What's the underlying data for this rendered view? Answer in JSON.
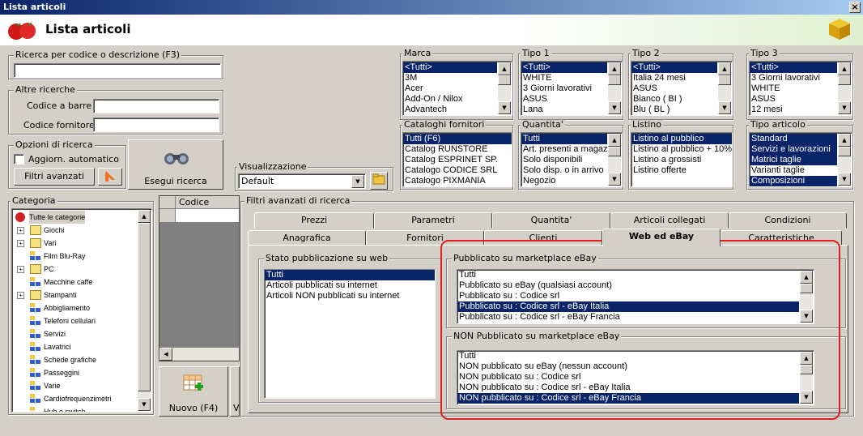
{
  "window": {
    "title": "Lista articoli"
  },
  "header": {
    "title": "Lista articoli"
  },
  "search": {
    "label": "Ricerca per codice o descrizione (F3)",
    "value": ""
  },
  "altre": {
    "label": "Altre ricerche",
    "barcode_label": "Codice a barre :",
    "supplier_label": "Codice fornitore :"
  },
  "opzioni": {
    "label": "Opzioni di ricerca",
    "auto_label": "Aggiorn. automatico",
    "filters_label": "Filtri avanzati"
  },
  "esegui": {
    "label": "Esegui ricerca"
  },
  "visualizzazione": {
    "label": "Visualizzazione",
    "value": "Default"
  },
  "marca": {
    "label": "Marca",
    "items": [
      "<Tutti>",
      "3M",
      "Acer",
      "Add-On / Nilox",
      "Advantech"
    ]
  },
  "tipo1": {
    "label": "Tipo 1",
    "items": [
      "<Tutti>",
      "WHITE",
      "3 Giorni lavorativi",
      "ASUS",
      "Lana"
    ]
  },
  "tipo2": {
    "label": "Tipo 2",
    "items": [
      "<Tutti>",
      "Italia 24 mesi",
      "ASUS",
      "Bianco ( BI )",
      "Blu ( BL )"
    ]
  },
  "tipo3": {
    "label": "Tipo 3",
    "items": [
      "<Tutti>",
      "3 Giorni lavorativi",
      "WHITE",
      "ASUS",
      "12 mesi"
    ]
  },
  "cataloghi": {
    "label": "Cataloghi fornitori",
    "items": [
      "Tutti (F6)",
      "Catalog RUNSTORE",
      "Catalog ESPRINET SP.",
      "Catalogo CODICE SRL",
      "Catalogo PIXMANIA"
    ]
  },
  "quantita": {
    "label": "Quantita'",
    "items": [
      "Tutti",
      "Art. presenti a magaz",
      "Solo disponibili",
      "Solo disp. o in arrivo",
      "Negozio"
    ]
  },
  "listino": {
    "label": "Listino",
    "items": [
      "Listino al pubblico",
      "Listino al pubblico + 10%",
      "Listino a grossisti",
      "Listino offerte"
    ]
  },
  "tipoart": {
    "label": "Tipo articolo",
    "items": [
      "Standard",
      "Servizi e lavorazioni",
      "Matrici taglie",
      "Varianti taglie",
      "Composizioni"
    ]
  },
  "categoria": {
    "label": "Categoria",
    "items": [
      "Tutte le categorie",
      "Giochi",
      "Vari",
      "Film Blu-Ray",
      "PC",
      "Macchine caffe",
      "Stampanti",
      "Abbigliamento",
      "Telefoni cellulari",
      "Servizi",
      "Lavatrici",
      "Schede grafiche",
      "Passeggini",
      "Varie",
      "Cardiofrequenzimetri",
      "Hub e switch"
    ]
  },
  "grid": {
    "col_codice": "Codice"
  },
  "nuovo": {
    "label": "Nuovo (F4)",
    "cut": "V"
  },
  "filtri": {
    "label": "Filtri avanzati di ricerca",
    "tabs_row1": [
      "Prezzi",
      "Parametri",
      "Quantita'",
      "Articoli collegati",
      "Condizioni"
    ],
    "tabs_row2": [
      "Anagrafica",
      "Fornitori",
      "Clienti",
      "Web ed eBay",
      "Caratteristiche"
    ]
  },
  "stato": {
    "label": "Stato pubblicazione su web",
    "items": [
      "Tutti",
      "Articoli pubblicati su internet",
      "Articoli NON pubblicati su internet"
    ]
  },
  "pubblicato": {
    "label": "Pubblicato su marketplace eBay",
    "items": [
      "Tutti",
      "Pubblicato su eBay (qualsiasi account)",
      "Pubblicato su : Codice srl",
      "Pubblicato su : Codice srl - eBay Italia",
      "Pubblicato su : Codice srl - eBay Francia"
    ]
  },
  "nonpubblicato": {
    "label": "NON Pubblicato su marketplace eBay",
    "items": [
      "Tutti",
      "NON pubblicato su eBay (nessun account)",
      "NON pubblicato su : Codice srl",
      "NON pubblicato su : Codice srl - eBay Italia",
      "NON pubblicato su : Codice srl - eBay Francia"
    ]
  },
  "colors": {
    "selection": "#0a246a",
    "highlight_border": "#e02020"
  }
}
